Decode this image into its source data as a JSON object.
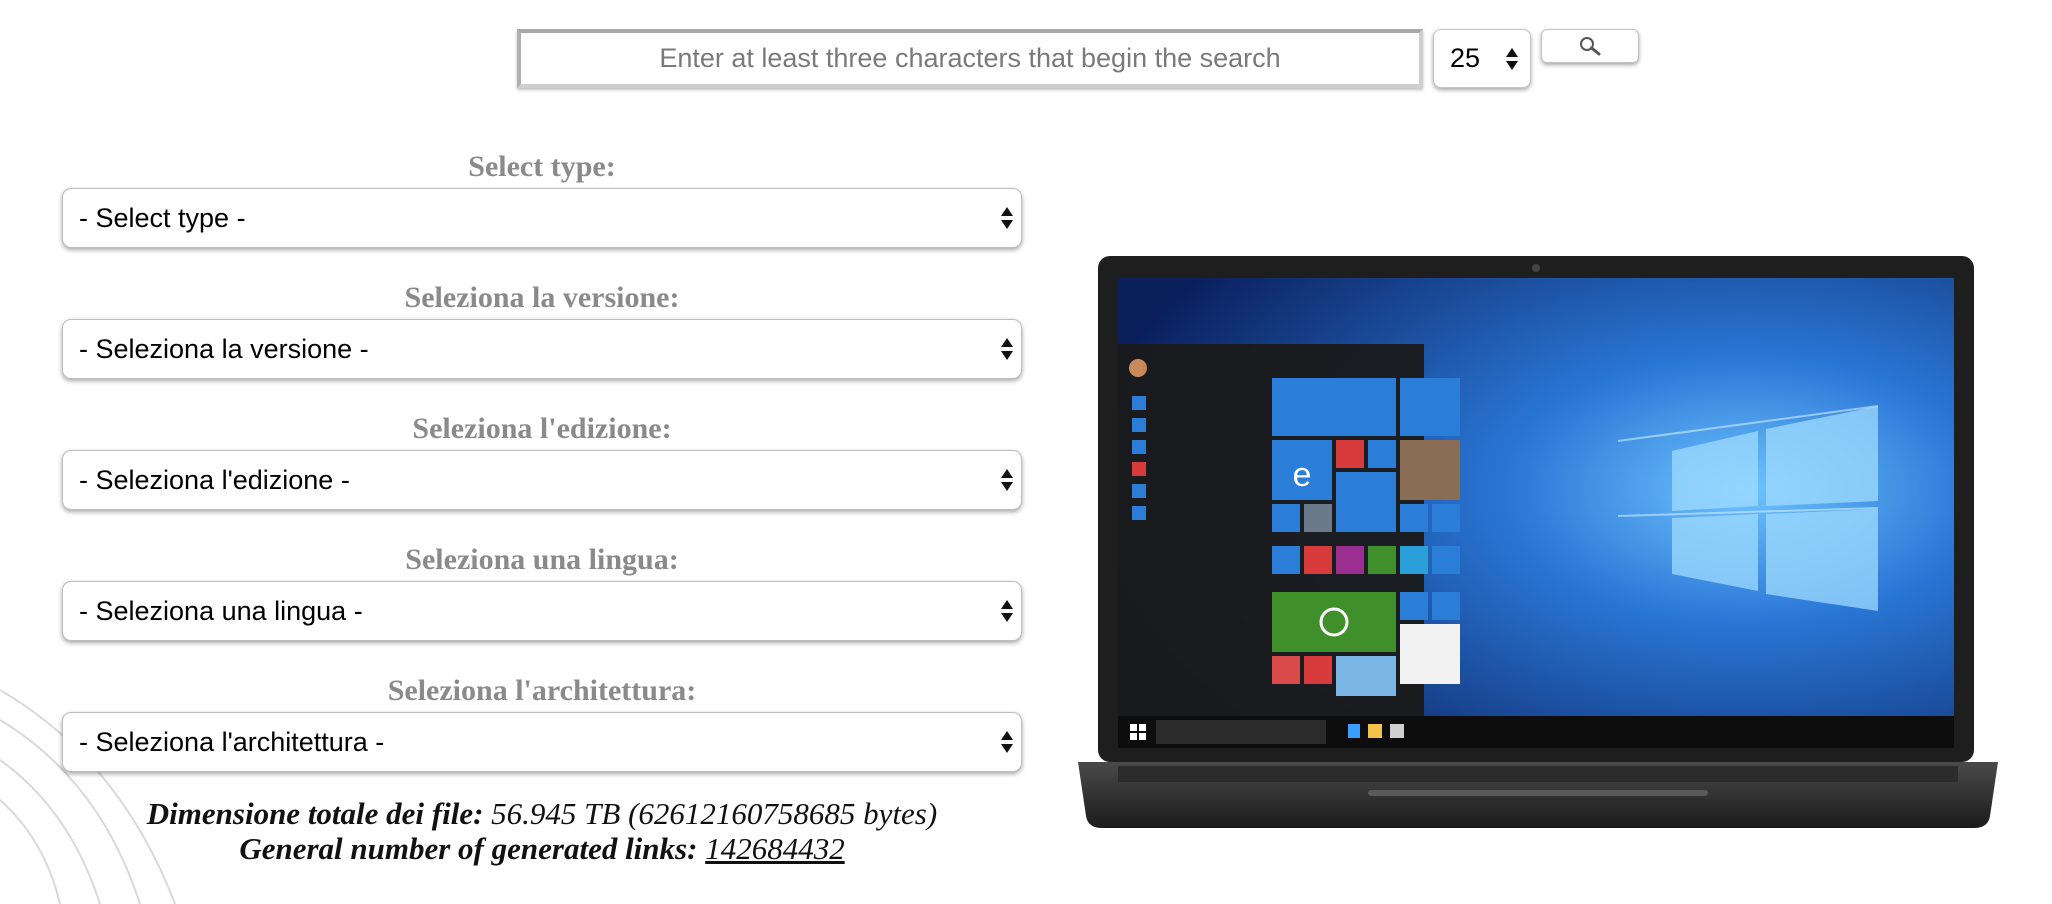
{
  "search": {
    "placeholder": "Enter at least three characters that begin the search",
    "count_value": "25"
  },
  "form": {
    "fields": [
      {
        "label": "Select type:",
        "value": "- Select type -"
      },
      {
        "label": "Seleziona la versione:",
        "value": "- Seleziona la versione -"
      },
      {
        "label": "Seleziona l'edizione:",
        "value": "- Seleziona l'edizione -"
      },
      {
        "label": "Seleziona una lingua:",
        "value": "- Seleziona una lingua -"
      },
      {
        "label": "Seleziona l'architettura:",
        "value": "- Seleziona l'architettura -"
      }
    ]
  },
  "totals": {
    "size_label": "Dimensione totale dei file:",
    "size_value": "56.945 TB (62612160758685 bytes)",
    "links_label": "General number of generated links:",
    "links_value": "142684432"
  },
  "colors": {
    "label_gray": "#8a8a8a",
    "wallpaper_blue": "#1f5fb8",
    "tile_blue": "#2a7ed8",
    "xbox_green": "#3f8f2a"
  },
  "icons": [
    "search-icon",
    "windows-logo-icon",
    "edge-icon",
    "xbox-icon"
  ]
}
